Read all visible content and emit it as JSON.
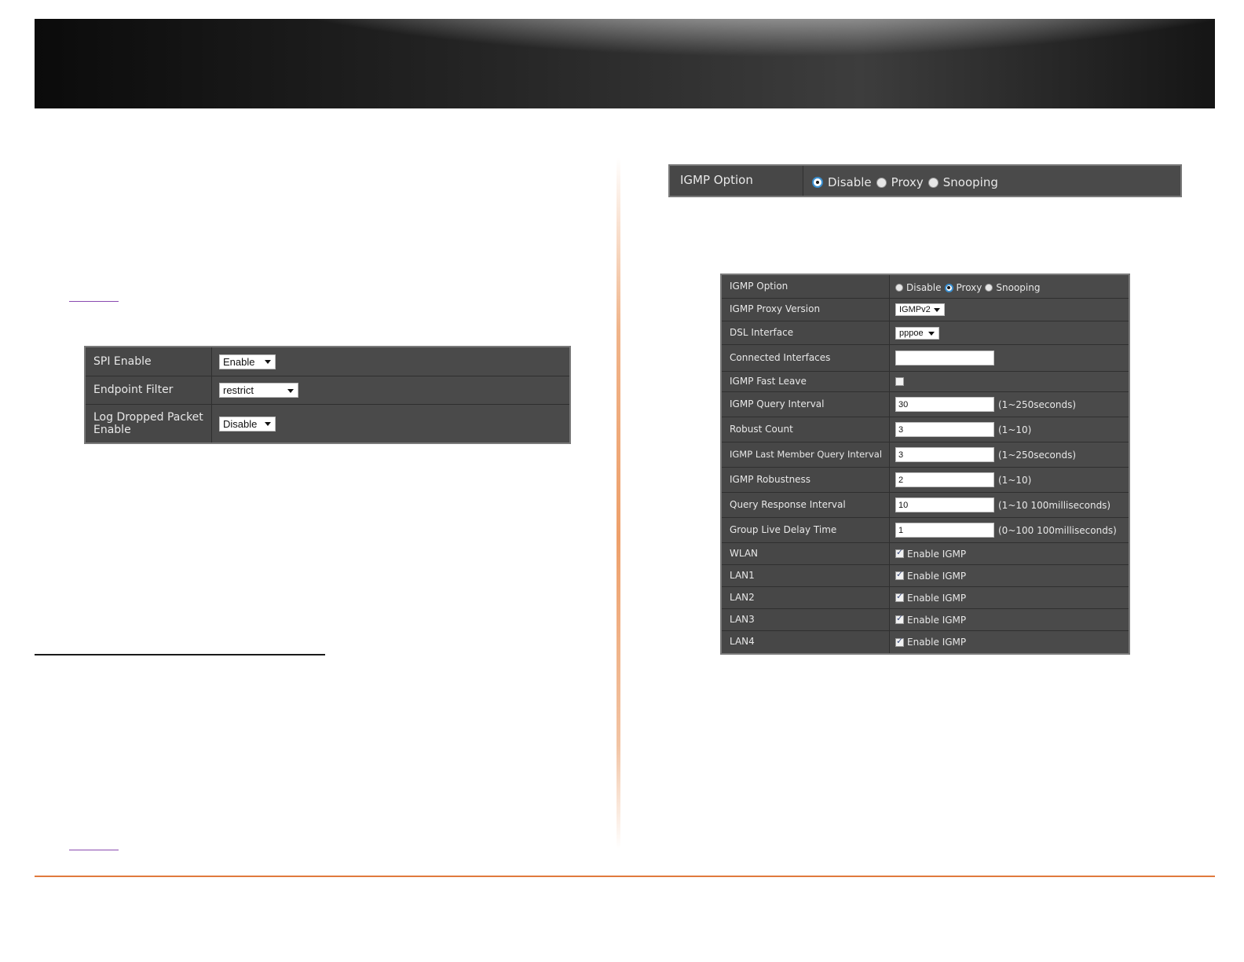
{
  "spi_table": {
    "rows": [
      {
        "label": "SPI Enable",
        "value": "Enable"
      },
      {
        "label": "Endpoint Filter",
        "value": "restrict"
      },
      {
        "label": "Log Dropped Packet Enable",
        "value": "Disable"
      }
    ]
  },
  "igmp_option_bar": {
    "label": "IGMP Option",
    "options": [
      "Disable",
      "Proxy",
      "Snooping"
    ],
    "selected": "Disable"
  },
  "igmp_table": {
    "option": {
      "label": "IGMP Option",
      "options": [
        "Disable",
        "Proxy",
        "Snooping"
      ],
      "selected": "Proxy"
    },
    "proxy_version": {
      "label": "IGMP Proxy Version",
      "value": "IGMPv2"
    },
    "dsl_interface": {
      "label": "DSL Interface",
      "value": "pppoe"
    },
    "connected_interfaces": {
      "label": "Connected Interfaces",
      "value": ""
    },
    "fast_leave": {
      "label": "IGMP Fast Leave",
      "checked": false
    },
    "query_interval": {
      "label": "IGMP Query Interval",
      "value": "30",
      "hint": "(1~250seconds)"
    },
    "robust_count": {
      "label": "Robust Count",
      "value": "3",
      "hint": "(1~10)"
    },
    "last_member_query_interval": {
      "label": "IGMP Last Member Query Interval",
      "value": "3",
      "hint": "(1~250seconds)"
    },
    "robustness": {
      "label": "IGMP Robustness",
      "value": "2",
      "hint": "(1~10)"
    },
    "query_response_interval": {
      "label": "Query Response Interval",
      "value": "10",
      "hint": "(1~10 100milliseconds)"
    },
    "group_live_delay_time": {
      "label": "Group Live Delay Time",
      "value": "1",
      "hint": "(0~100 100milliseconds)"
    },
    "interfaces": [
      {
        "label": "WLAN",
        "option": "Enable IGMP",
        "checked": true
      },
      {
        "label": "LAN1",
        "option": "Enable IGMP",
        "checked": true
      },
      {
        "label": "LAN2",
        "option": "Enable IGMP",
        "checked": true
      },
      {
        "label": "LAN3",
        "option": "Enable IGMP",
        "checked": true
      },
      {
        "label": "LAN4",
        "option": "Enable IGMP",
        "checked": true
      }
    ]
  }
}
